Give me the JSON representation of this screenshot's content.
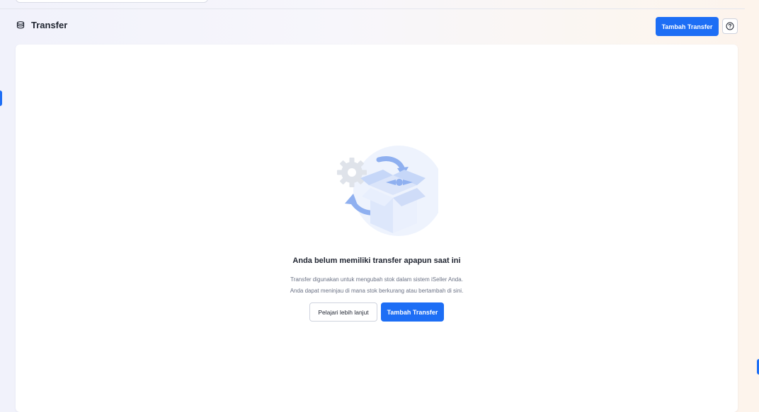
{
  "page": {
    "title": "Transfer",
    "title_icon": "transfer-stack-icon",
    "add_button_label": "Tambah Transfer",
    "help_icon": "help-circle-icon"
  },
  "empty_state": {
    "illustration": "open-box-with-arrows-illustration",
    "title": "Anda belum memiliki transfer apapun saat ini",
    "description_line1": "Transfer digunakan untuk mengubah stok dalam sistem iSeller Anda.",
    "description_line2": "Anda dapat meninjau di mana stok berkurang atau bertambah di sini.",
    "learn_more_label": "Pelajari lebih lanjut",
    "add_button_label": "Tambah Transfer"
  },
  "colors": {
    "accent": "#1d6ef5",
    "illustration_light": "#e3ebfb",
    "illustration_mid": "#b9cdf6",
    "illustration_dark": "#8fb0f0"
  }
}
